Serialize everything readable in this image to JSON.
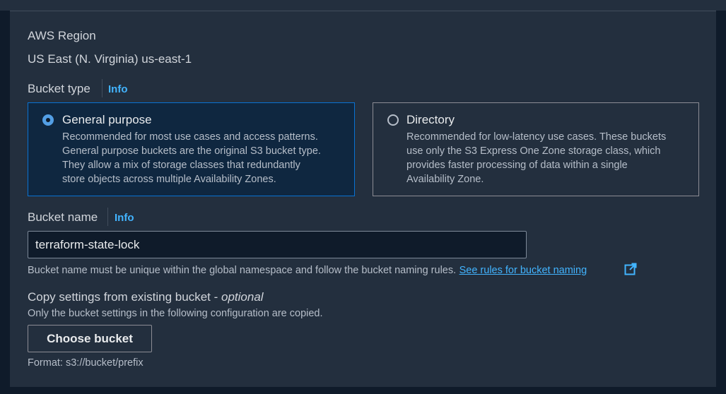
{
  "region": {
    "label": "AWS Region",
    "value": "US East (N. Virginia) us-east-1"
  },
  "bucket_type": {
    "label": "Bucket type",
    "info": "Info",
    "options": [
      {
        "title": "General purpose",
        "selected": true,
        "desc_lines": [
          "Recommended for most use cases and access patterns.",
          "General purpose buckets are the original S3 bucket type.",
          "They allow a mix of storage classes that redundantly",
          "store objects across multiple Availability Zones."
        ]
      },
      {
        "title": "Directory",
        "selected": false,
        "desc_lines": [
          "Recommended for low-latency use cases. These buckets",
          "use only the S3 Express One Zone storage class, which",
          "provides faster processing of data within a single",
          "Availability Zone."
        ]
      }
    ]
  },
  "bucket_name": {
    "label": "Bucket name",
    "info": "Info",
    "value": "terraform-state-lock",
    "hint": "Bucket name must be unique within the global namespace and follow the bucket naming rules.",
    "link": "See rules for bucket naming"
  },
  "copy_settings": {
    "label": "Copy settings from existing bucket - ",
    "optional": "optional",
    "desc": "Only the bucket settings in the following configuration are copied.",
    "button": "Choose bucket",
    "format": "Format: s3://bucket/prefix"
  },
  "colors": {
    "accent": "#42b4ff",
    "selected_border": "#0972d3",
    "panel_bg": "#232f3e"
  }
}
